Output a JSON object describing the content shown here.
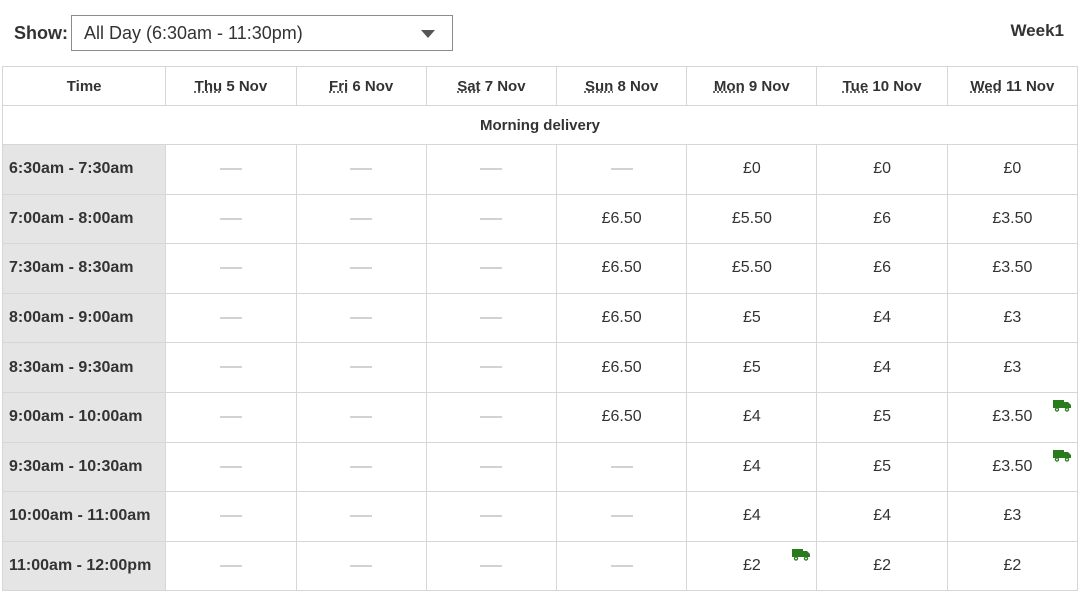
{
  "header": {
    "show_label": "Show:",
    "show_selected": "All Day (6:30am - 11:30pm)",
    "week_label": "Week1"
  },
  "table": {
    "time_header": "Time",
    "days": [
      {
        "abbr": "Thu",
        "date": " 5 Nov"
      },
      {
        "abbr": "Fri",
        "date": " 6 Nov"
      },
      {
        "abbr": "Sat",
        "date": " 7 Nov"
      },
      {
        "abbr": "Sun",
        "date": " 8 Nov"
      },
      {
        "abbr": "Mon",
        "date": " 9 Nov"
      },
      {
        "abbr": "Tue",
        "date": " 10 Nov"
      },
      {
        "abbr": "Wed",
        "date": " 11 Nov"
      }
    ],
    "section_label": "Morning delivery",
    "rows": [
      {
        "time": "6:30am - 7:30am",
        "cells": [
          "",
          "",
          "",
          "",
          "£0",
          "£0",
          "£0"
        ],
        "truck": [
          false,
          false,
          false,
          false,
          false,
          false,
          false
        ]
      },
      {
        "time": "7:00am - 8:00am",
        "cells": [
          "",
          "",
          "",
          "£6.50",
          "£5.50",
          "£6",
          "£3.50"
        ],
        "truck": [
          false,
          false,
          false,
          false,
          false,
          false,
          false
        ]
      },
      {
        "time": "7:30am - 8:30am",
        "cells": [
          "",
          "",
          "",
          "£6.50",
          "£5.50",
          "£6",
          "£3.50"
        ],
        "truck": [
          false,
          false,
          false,
          false,
          false,
          false,
          false
        ]
      },
      {
        "time": "8:00am - 9:00am",
        "cells": [
          "",
          "",
          "",
          "£6.50",
          "£5",
          "£4",
          "£3"
        ],
        "truck": [
          false,
          false,
          false,
          false,
          false,
          false,
          false
        ]
      },
      {
        "time": "8:30am - 9:30am",
        "cells": [
          "",
          "",
          "",
          "£6.50",
          "£5",
          "£4",
          "£3"
        ],
        "truck": [
          false,
          false,
          false,
          false,
          false,
          false,
          false
        ]
      },
      {
        "time": "9:00am - 10:00am",
        "cells": [
          "",
          "",
          "",
          "£6.50",
          "£4",
          "£5",
          "£3.50"
        ],
        "truck": [
          false,
          false,
          false,
          false,
          false,
          false,
          true
        ]
      },
      {
        "time": "9:30am - 10:30am",
        "cells": [
          "",
          "",
          "",
          "",
          "£4",
          "£5",
          "£3.50"
        ],
        "truck": [
          false,
          false,
          false,
          false,
          false,
          false,
          true
        ]
      },
      {
        "time": "10:00am - 11:00am",
        "cells": [
          "",
          "",
          "",
          "",
          "£4",
          "£4",
          "£3"
        ],
        "truck": [
          false,
          false,
          false,
          false,
          false,
          false,
          false
        ]
      },
      {
        "time": "11:00am - 12:00pm",
        "cells": [
          "",
          "",
          "",
          "",
          "£2",
          "£2",
          "£2"
        ],
        "truck": [
          false,
          false,
          false,
          false,
          true,
          false,
          false
        ]
      }
    ]
  },
  "icons": {
    "dropdown": "chevron-down-icon",
    "unavailable": "dash-icon",
    "delivery": "truck-icon"
  },
  "colors": {
    "truck_green": "#2a7a1e",
    "time_col_bg": "#e5e5e5",
    "dash_gray": "#d2d2d2"
  }
}
